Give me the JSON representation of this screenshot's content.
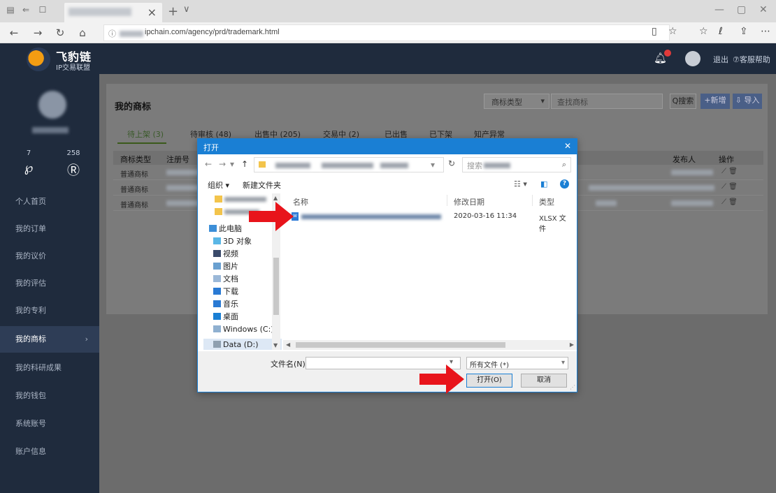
{
  "browser": {
    "url_visible": "ipchain.com/agency/prd/trademark.html",
    "new_tab": "+",
    "tab_list": "∨"
  },
  "app": {
    "logo_title": "飞豹链",
    "logo_sub": "IP交易联盟",
    "header_links": [
      "退出",
      "⑦客服帮助"
    ]
  },
  "sidebar": {
    "stats": [
      {
        "value": "7"
      },
      {
        "value": "258"
      }
    ],
    "items": [
      {
        "label": "个人首页"
      },
      {
        "label": "我的订单"
      },
      {
        "label": "我的议价"
      },
      {
        "label": "我的评估"
      },
      {
        "label": "我的专利"
      },
      {
        "label": "我的商标",
        "active": true
      },
      {
        "label": "我的科研成果"
      },
      {
        "label": "我的钱包"
      },
      {
        "label": "系统账号"
      },
      {
        "label": "账户信息"
      }
    ]
  },
  "main": {
    "title": "我的商标",
    "filter_select": "商标类型",
    "search_placeholder": "查找商标",
    "buttons": {
      "search": "Q搜索",
      "add": "+新增",
      "import": "⇩ 导入"
    },
    "tabs": [
      {
        "label": "待上架 (3)",
        "active": true
      },
      {
        "label": "待审核 (48)"
      },
      {
        "label": "出售中 (205)"
      },
      {
        "label": "交易中 (2)"
      },
      {
        "label": "已出售"
      },
      {
        "label": "已下架"
      },
      {
        "label": "知产异常"
      }
    ],
    "table": {
      "headers": [
        "商标类型",
        "注册号",
        "发布人",
        "操作"
      ],
      "rows": [
        {
          "type": "普通商标",
          "ops": "⟋ 🗑"
        },
        {
          "type": "普通商标",
          "ops": "⟋ 🗑"
        },
        {
          "type": "普通商标",
          "ops": "⟋ 🗑"
        }
      ]
    }
  },
  "dialog": {
    "title": "打开",
    "search_label": "搜索",
    "toolbar": {
      "organize": "组织 ▾",
      "new_folder": "新建文件夹"
    },
    "tree": [
      {
        "label": "此电脑",
        "icon": "pc-icon"
      },
      {
        "label": "3D 对象",
        "icon": "cube-icon"
      },
      {
        "label": "视频",
        "icon": "video-icon"
      },
      {
        "label": "图片",
        "icon": "picture-icon"
      },
      {
        "label": "文档",
        "icon": "document-icon"
      },
      {
        "label": "下载",
        "icon": "download-icon"
      },
      {
        "label": "音乐",
        "icon": "music-icon"
      },
      {
        "label": "桌面",
        "icon": "desktop-icon"
      },
      {
        "label": "Windows (C:)",
        "icon": "drive-icon"
      },
      {
        "label": "Data (D:)",
        "icon": "drive-icon"
      }
    ],
    "columns": {
      "name": "名称",
      "modified": "修改日期",
      "type": "类型"
    },
    "file": {
      "modified": "2020-03-16 11:34",
      "type": "XLSX 文件"
    },
    "filename_label": "文件名(N):",
    "filename_value": "",
    "filetype": "所有文件 (*)",
    "open_button": "打开(O)",
    "cancel_button": "取消"
  },
  "colors": {
    "header_bg": "#1f2b3d",
    "dialog_accent": "#1a7fd4",
    "arrow": "#e8141b"
  }
}
